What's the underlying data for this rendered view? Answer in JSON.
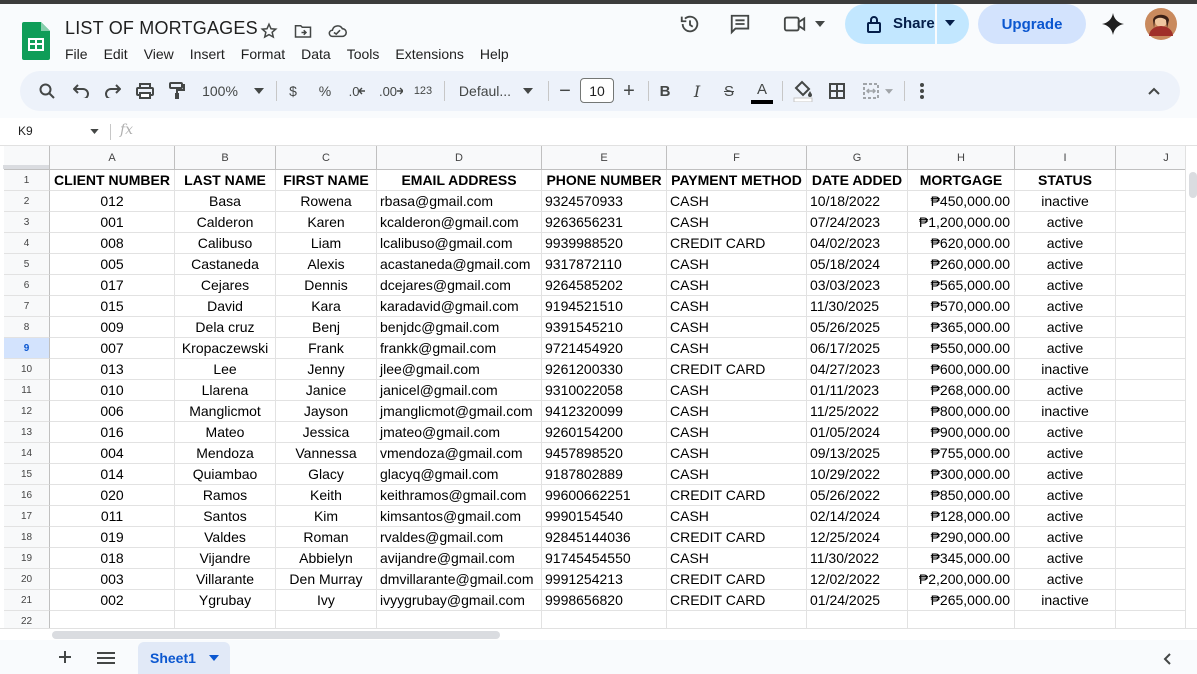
{
  "doc": {
    "title": "LIST OF MORTGAGES"
  },
  "menu": [
    "File",
    "Edit",
    "View",
    "Insert",
    "Format",
    "Data",
    "Tools",
    "Extensions",
    "Help"
  ],
  "actions": {
    "share_label": "Share",
    "upgrade_label": "Upgrade"
  },
  "toolbar": {
    "zoom": "100%",
    "currency": "$",
    "percent": "%",
    "dec_decrease": ".0",
    "dec_increase": ".00",
    "number_format": "123",
    "font": "Defaul...",
    "font_size": "10",
    "bold": "B",
    "italic": "I",
    "strike": "S",
    "text_color": "A"
  },
  "formula_bar": {
    "name_box": "K9",
    "fx": "fx"
  },
  "columns": [
    "A",
    "B",
    "C",
    "D",
    "E",
    "F",
    "G",
    "H",
    "I",
    "J"
  ],
  "row_numbers": [
    "1",
    "2",
    "3",
    "4",
    "5",
    "6",
    "7",
    "8",
    "9",
    "10",
    "11",
    "12",
    "13",
    "14",
    "15",
    "16",
    "17",
    "18",
    "19",
    "20",
    "21",
    "22"
  ],
  "selected_row": "9",
  "headers": [
    "CLIENT NUMBER",
    "LAST NAME",
    "FIRST NAME",
    "EMAIL ADDRESS",
    "PHONE NUMBER",
    "PAYMENT METHOD",
    "DATE ADDED",
    "MORTGAGE",
    "STATUS"
  ],
  "rows": [
    [
      "012",
      "Basa",
      "Rowena",
      "rbasa@gmail.com",
      "9324570933",
      "CASH",
      "10/18/2022",
      "₱450,000.00",
      "inactive"
    ],
    [
      "001",
      "Calderon",
      "Karen",
      "kcalderon@gmail.com",
      "9263656231",
      "CASH",
      "07/24/2023",
      "₱1,200,000.00",
      "active"
    ],
    [
      "008",
      "Calibuso",
      "Liam",
      "lcalibuso@gmail.com",
      "9939988520",
      "CREDIT CARD",
      "04/02/2023",
      "₱620,000.00",
      "active"
    ],
    [
      "005",
      "Castaneda",
      "Alexis",
      "acastaneda@gmail.com",
      "9317872110",
      "CASH",
      "05/18/2024",
      "₱260,000.00",
      "active"
    ],
    [
      "017",
      "Cejares",
      "Dennis",
      "dcejares@gmail.com",
      "9264585202",
      "CASH",
      "03/03/2023",
      "₱565,000.00",
      "active"
    ],
    [
      "015",
      "David",
      "Kara",
      "karadavid@gmail.com",
      "9194521510",
      "CASH",
      "11/30/2025",
      "₱570,000.00",
      "active"
    ],
    [
      "009",
      "Dela cruz",
      "Benj",
      "benjdc@gmail.com",
      "9391545210",
      "CASH",
      "05/26/2025",
      "₱365,000.00",
      "active"
    ],
    [
      "007",
      "Kropaczewski",
      "Frank",
      "frankk@gmail.com",
      "9721454920",
      "CASH",
      "06/17/2025",
      "₱550,000.00",
      "active"
    ],
    [
      "013",
      "Lee",
      "Jenny",
      "jlee@gmail.com",
      "9261200330",
      "CREDIT CARD",
      "04/27/2023",
      "₱600,000.00",
      "inactive"
    ],
    [
      "010",
      "Llarena",
      "Janice",
      "janicel@gmail.com",
      "9310022058",
      "CASH",
      "01/11/2023",
      "₱268,000.00",
      "active"
    ],
    [
      "006",
      "Manglicmot",
      "Jayson",
      "jmanglicmot@gmail.com",
      "9412320099",
      "CASH",
      "11/25/2022",
      "₱800,000.00",
      "inactive"
    ],
    [
      "016",
      "Mateo",
      "Jessica",
      "jmateo@gmail.com",
      "9260154200",
      "CASH",
      "01/05/2024",
      "₱900,000.00",
      "active"
    ],
    [
      "004",
      "Mendoza",
      "Vannessa",
      "vmendoza@gmail.com",
      "9457898520",
      "CASH",
      "09/13/2025",
      "₱755,000.00",
      "active"
    ],
    [
      "014",
      "Quiambao",
      "Glacy",
      "glacyq@gmail.com",
      "9187802889",
      "CASH",
      "10/29/2022",
      "₱300,000.00",
      "active"
    ],
    [
      "020",
      "Ramos",
      "Keith",
      "keithramos@gmail.com",
      "99600662251",
      "CREDIT CARD",
      "05/26/2022",
      "₱850,000.00",
      "active"
    ],
    [
      "011",
      "Santos",
      "Kim",
      "kimsantos@gmail.com",
      "9990154540",
      "CASH",
      "02/14/2024",
      "₱128,000.00",
      "active"
    ],
    [
      "019",
      "Valdes",
      "Roman",
      "rvaldes@gmail.com",
      "92845144036",
      "CREDIT CARD",
      "12/25/2024",
      "₱290,000.00",
      "active"
    ],
    [
      "018",
      "Vijandre",
      "Abbielyn",
      "avijandre@gmail.com",
      "91745454550",
      "CASH",
      "11/30/2022",
      "₱345,000.00",
      "active"
    ],
    [
      "003",
      "Villarante",
      "Den Murray",
      "dmvillarante@gmail.com",
      "9991254213",
      "CREDIT CARD",
      "12/02/2022",
      "₱2,200,000.00",
      "active"
    ],
    [
      "002",
      "Ygrubay",
      "Ivy",
      "ivyygrubay@gmail.com",
      "9998656820",
      "CREDIT CARD",
      "01/24/2025",
      "₱265,000.00",
      "inactive"
    ]
  ],
  "sheet_tab": "Sheet1",
  "colors": {
    "accent": "#0b57d0",
    "share_bg": "#c2e7ff",
    "upgrade_bg": "#d3e3fd",
    "sheets_green": "#0f9d58"
  }
}
